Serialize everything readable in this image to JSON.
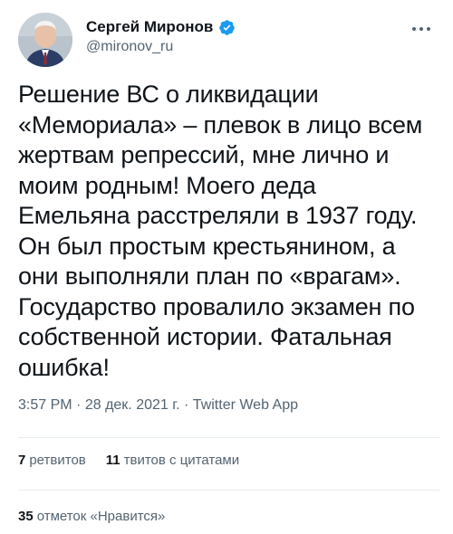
{
  "author": {
    "name": "Сергей Миронов",
    "handle": "@mironov_ru",
    "verified": true,
    "verified_color": "#1d9bf0"
  },
  "tweet": {
    "text": "Решение ВС о ликвидации\n«Мемориала» – плевок в лицо всем\nжертвам репрессий, мне лично и\nмоим родным! Моего деда\nЕмельяна расстреляли в 1937 году.\nОн был простым крестьянином, а\nони выполняли план по «врагам».\nГосударство провалило экзамен по\nсобственной истории. Фатальная\nошибка!",
    "time": "3:57 PM",
    "date": "28 дек. 2021 г.",
    "source": "Twitter Web App",
    "separator": "·"
  },
  "stats": {
    "retweets_count": "7",
    "retweets_label": "ретвитов",
    "quotes_count": "11",
    "quotes_label": "твитов с цитатами",
    "likes_count": "35",
    "likes_label": "отметок «Нравится»"
  },
  "icons": {
    "verified": "verified-badge-icon",
    "more": "more-options-icon"
  }
}
